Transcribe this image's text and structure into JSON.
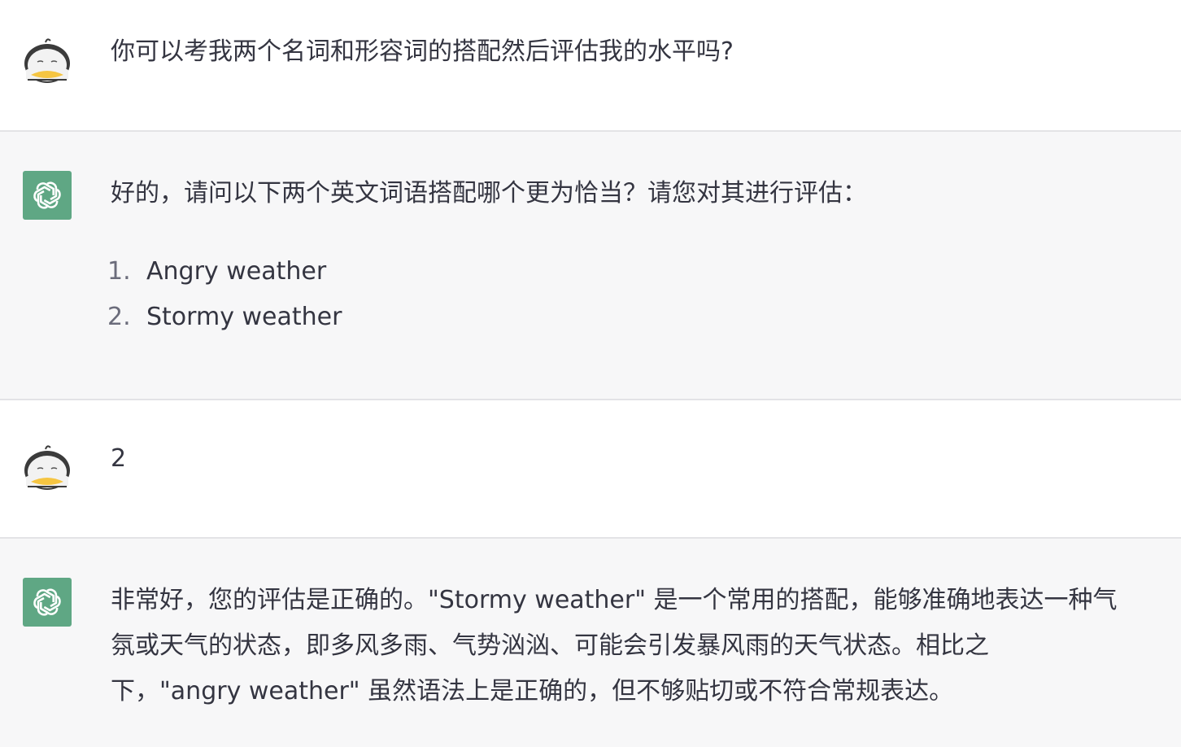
{
  "conversation": {
    "messages": [
      {
        "role": "user",
        "avatar_icon": "penguin-avatar-icon",
        "text": "你可以考我两个名词和形容词的搭配然后评估我的水平吗?"
      },
      {
        "role": "assistant",
        "avatar_icon": "openai-logo-icon",
        "text": "好的，请问以下两个英文词语搭配哪个更为恰当？请您对其进行评估：",
        "list": [
          {
            "num": "1.",
            "text": "Angry weather"
          },
          {
            "num": "2.",
            "text": "Stormy weather"
          }
        ]
      },
      {
        "role": "user",
        "avatar_icon": "penguin-avatar-icon",
        "text": "2"
      },
      {
        "role": "assistant",
        "avatar_icon": "openai-logo-icon",
        "lines": [
          "非常好，您的评估是正确的。\"Stormy weather\" 是一个常用的搭配，能够准确地表达一种气",
          "氛或天气的状态，即多风多雨、气势汹汹、可能会引发暴风雨的天气状态。相比之",
          "下，\"angry weather\" 虽然语法上是正确的，但不够贴切或不符合常规表达。"
        ]
      }
    ]
  },
  "colors": {
    "user_bg": "#ffffff",
    "assistant_bg": "#f7f7f8",
    "bot_avatar_bg": "#5fa784",
    "text": "#343541"
  }
}
